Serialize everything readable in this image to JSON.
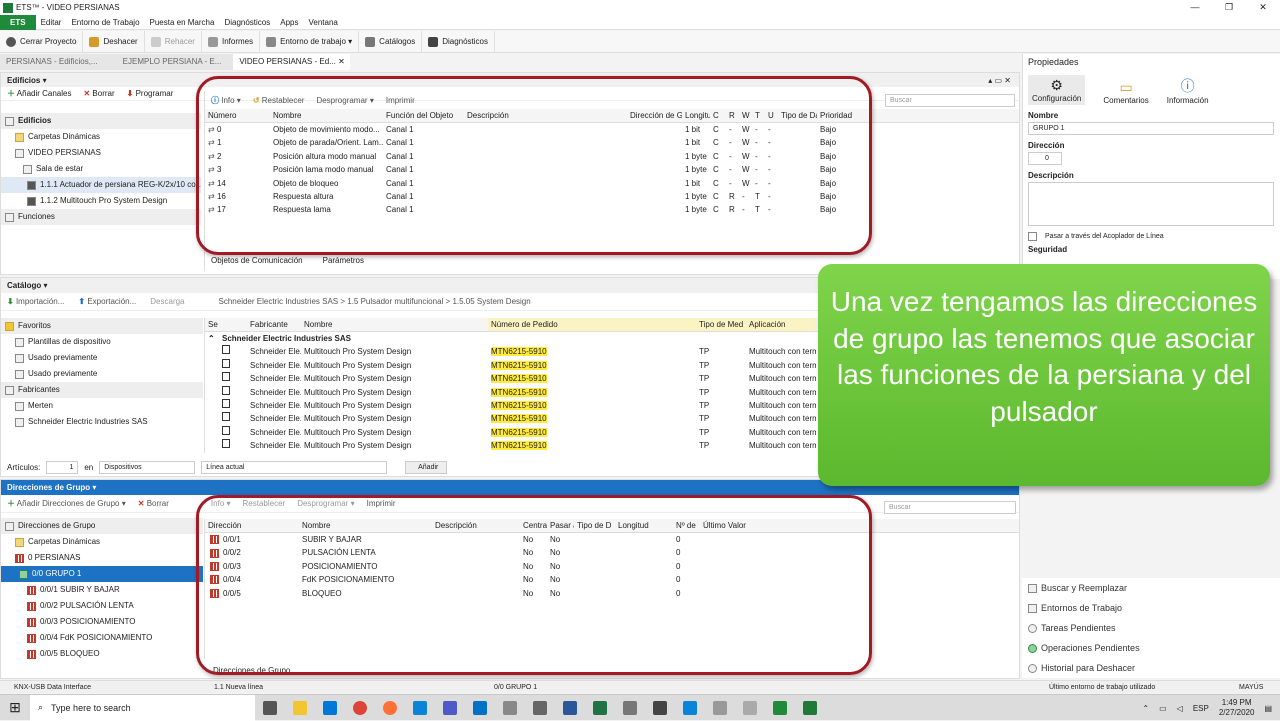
{
  "title": "ETS™ - VIDEO PERSIANAS",
  "menu": [
    "ETS",
    "Editar",
    "Entorno de Trabajo",
    "Puesta en Marcha",
    "Diagnósticos",
    "Apps",
    "Ventana"
  ],
  "toolbar": [
    "Cerrar Proyecto",
    "Deshacer",
    "Rehacer",
    "Informes",
    "Entorno de trabajo",
    "Catálogos",
    "Diagnósticos"
  ],
  "doc_tabs": [
    "PERSIANAS - Edificios,...",
    "EJEMPLO PERSIANA - E...",
    "VIDEO PERSIANAS - Ed..."
  ],
  "edificios": {
    "title": "Edificios",
    "actions": [
      "Añadir Canales",
      "Borrar",
      "Programar"
    ],
    "tree": [
      "Edificios",
      "Carpetas Dinámicas",
      "VIDEO PERSIANAS",
      "Sala de estar",
      "1.1.1 Actuador de persiana REG-K/2x/10 co...",
      "1.1.2 Multitouch Pro System Design",
      "Funciones"
    ]
  },
  "objects": {
    "actions": [
      "Info",
      "Restablecer",
      "Desprogramar",
      "Imprimir"
    ],
    "search_placeholder": "Buscar",
    "headers": [
      "Número",
      "Nombre",
      "Función del Objeto",
      "Descripción",
      "Dirección de G",
      "Longitu",
      "C",
      "R",
      "W",
      "T",
      "U",
      "Tipo de Da",
      "Prioridad"
    ],
    "rows": [
      [
        "0",
        "Objeto de movimiento modo...",
        "Canal 1",
        "",
        "",
        "1 bit",
        "C",
        "-",
        "W",
        "-",
        "-",
        "",
        "Bajo"
      ],
      [
        "1",
        "Objeto de parada/Orient. Lam...",
        "Canal 1",
        "",
        "",
        "1 bit",
        "C",
        "-",
        "W",
        "-",
        "-",
        "",
        "Bajo"
      ],
      [
        "2",
        "Posición altura modo manual",
        "Canal 1",
        "",
        "",
        "1 byte",
        "C",
        "-",
        "W",
        "-",
        "-",
        "",
        "Bajo"
      ],
      [
        "3",
        "Posición lama modo manual",
        "Canal 1",
        "",
        "",
        "1 byte",
        "C",
        "-",
        "W",
        "-",
        "-",
        "",
        "Bajo"
      ],
      [
        "14",
        "Objeto de bloqueo",
        "Canal 1",
        "",
        "",
        "1 bit",
        "C",
        "-",
        "W",
        "-",
        "-",
        "",
        "Bajo"
      ],
      [
        "16",
        "Respuesta altura",
        "Canal 1",
        "",
        "",
        "1 byte",
        "C",
        "R",
        "-",
        "T",
        "-",
        "",
        "Bajo"
      ],
      [
        "17",
        "Respuesta lama",
        "Canal 1",
        "",
        "",
        "1 byte",
        "C",
        "R",
        "-",
        "T",
        "-",
        "",
        "Bajo"
      ]
    ],
    "bottom_tabs": [
      "Objetos de Comunicación",
      "Parámetros"
    ]
  },
  "catalogo": {
    "title": "Catálogo",
    "actions": [
      "Importación...",
      "Exportación...",
      "Descarga"
    ],
    "breadcrumb": [
      "Schneider Electric Industries SAS",
      "1.5 Pulsador multifuncional",
      "1.5.05 System Design"
    ],
    "tree": [
      "Favoritos",
      "Plantillas de dispositivo",
      "Usado previamente",
      "Usado previamente",
      "Fabricantes",
      "Merten",
      "Schneider Electric Industries SAS"
    ],
    "headers": [
      "Se",
      "Fabricante",
      "Nombre",
      "Número de Pedido",
      "Tipo de Med",
      "Aplicación"
    ],
    "group": "Schneider Electric Industries SAS",
    "rows": [
      [
        "Schneider Ele...",
        "Multitouch Pro System Design",
        "MTN6215-5910",
        "TP",
        "Multitouch con term"
      ],
      [
        "Schneider Ele...",
        "Multitouch Pro System Design",
        "MTN6215-5910",
        "TP",
        "Multitouch con term"
      ],
      [
        "Schneider Ele...",
        "Multitouch Pro System Design",
        "MTN6215-5910",
        "TP",
        "Multitouch con term"
      ],
      [
        "Schneider Ele...",
        "Multitouch Pro System Design",
        "MTN6215-5910",
        "TP",
        "Multitouch con term"
      ],
      [
        "Schneider Ele...",
        "Multitouch Pro System Design",
        "MTN6215-5910",
        "TP",
        "Multitouch con term"
      ],
      [
        "Schneider Ele...",
        "Multitouch Pro System Design",
        "MTN6215-5910",
        "TP",
        "Multitouch con term"
      ],
      [
        "Schneider Ele...",
        "Multitouch Pro System Design",
        "MTN6215-5910",
        "TP",
        "Multitouch con term"
      ],
      [
        "Schneider Ele...",
        "Multitouch Pro System Design",
        "MTN6215-5910",
        "TP",
        "Multitouch con term"
      ]
    ],
    "footer": {
      "articulos_label": "Artículos:",
      "articulos_value": "1",
      "en": "en",
      "dispositivos": "Dispositivos",
      "linea": "Línea actual",
      "anadir": "Añadir"
    }
  },
  "grupos": {
    "title": "Direcciones de Grupo",
    "actions": [
      "Añadir Direcciones de Grupo",
      "Borrar",
      "Info",
      "Restablecer",
      "Desprogramar",
      "Imprimir"
    ],
    "search_placeholder": "Buscar",
    "tree": [
      "Direcciones de Grupo",
      "Carpetas Dinámicas",
      "0 PERSIANAS",
      "0/0 GRUPO 1",
      "0/0/1 SUBIR Y BAJAR",
      "0/0/2 PULSACIÓN LENTA",
      "0/0/3 POSICIONAMIENTO",
      "0/0/4 FdK POSICIONAMIENTO",
      "0/0/5 BLOQUEO"
    ],
    "headers": [
      "Dirección",
      "Nombre",
      "Descripción",
      "Centra",
      "Pasar a",
      "Tipo de D",
      "Longitud",
      "Nº de",
      "Último Valor"
    ],
    "rows": [
      [
        "0/0/1",
        "SUBIR Y BAJAR",
        "",
        "No",
        "No",
        "",
        "",
        "0",
        ""
      ],
      [
        "0/0/2",
        "PULSACIÓN LENTA",
        "",
        "No",
        "No",
        "",
        "",
        "0",
        ""
      ],
      [
        "0/0/3",
        "POSICIONAMIENTO",
        "",
        "No",
        "No",
        "",
        "",
        "0",
        ""
      ],
      [
        "0/0/4",
        "FdK POSICIONAMIENTO",
        "",
        "No",
        "No",
        "",
        "",
        "0",
        ""
      ],
      [
        "0/0/5",
        "BLOQUEO",
        "",
        "No",
        "No",
        "",
        "",
        "0",
        ""
      ]
    ],
    "bottom_tab": "Direcciones de Grupo"
  },
  "propiedades": {
    "title": "Propiedades",
    "tabs": [
      "Configuración",
      "Comentarios",
      "Información"
    ],
    "nombre_label": "Nombre",
    "nombre_value": "GRUPO 1",
    "direccion_label": "Dirección",
    "direccion_value": "0",
    "descripcion_label": "Descripción",
    "pasar": "Pasar a través del Acoplador de Línea",
    "seguridad": "Seguridad",
    "links": [
      "Buscar y Reemplazar",
      "Entornos de Trabajo",
      "Tareas Pendientes",
      "Operaciones Pendientes",
      "Historial para Deshacer"
    ]
  },
  "callout": "Una vez tengamos las direcciones de grupo las tenemos que asociar las funciones de la persiana y del pulsador",
  "status": {
    "interface": "KNX-USB Data Interface",
    "line": "1.1 Nueva línea",
    "group": "0/0 GRUPO 1",
    "workspace": "Último entorno de trabajo utilizado",
    "caps": "MAYÚS"
  },
  "taskbar": {
    "search": "Type here to search",
    "lang": "ESP",
    "time": "1:49 PM",
    "date": "2/27/2020"
  },
  "colors": {
    "accent": "#1e72c4",
    "ets_green": "#1f8a3c",
    "callout": "#6cc63b",
    "highlight": "#ffeb3b",
    "annotation_red": "#a11a24"
  }
}
